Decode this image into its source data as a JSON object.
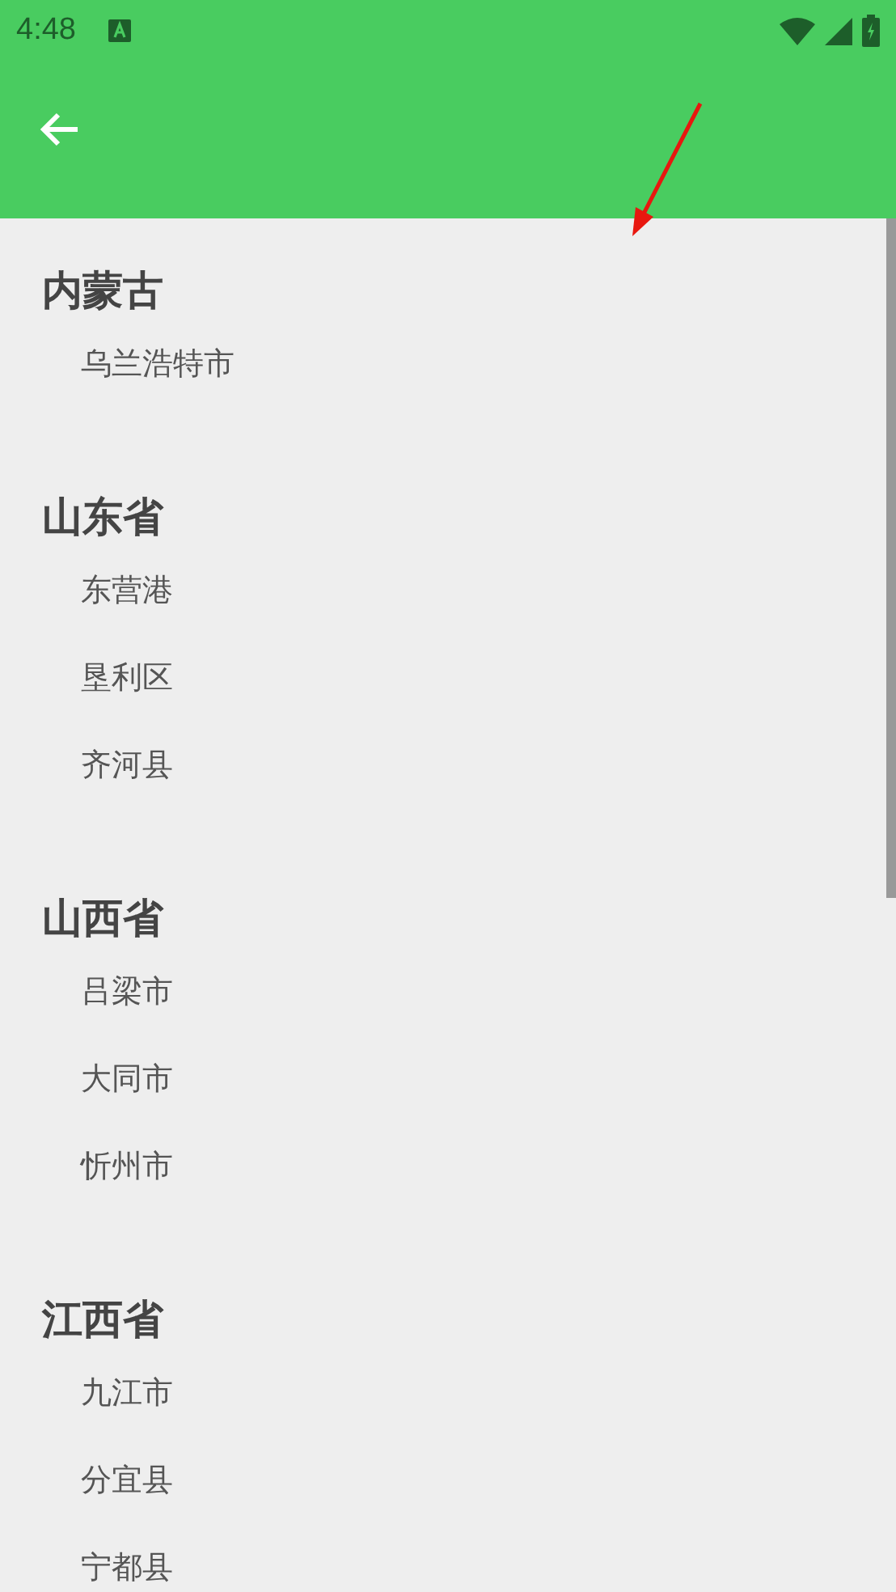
{
  "status_bar": {
    "time": "4:48"
  },
  "groups": [
    {
      "title": "内蒙古",
      "items": [
        "乌兰浩特市"
      ]
    },
    {
      "title": "山东省",
      "items": [
        "东营港",
        "垦利区",
        "齐河县"
      ]
    },
    {
      "title": "山西省",
      "items": [
        "吕梁市",
        "大同市",
        "忻州市"
      ]
    },
    {
      "title": "江西省",
      "items": [
        "九江市",
        "分宜县",
        "宁都县"
      ]
    }
  ]
}
